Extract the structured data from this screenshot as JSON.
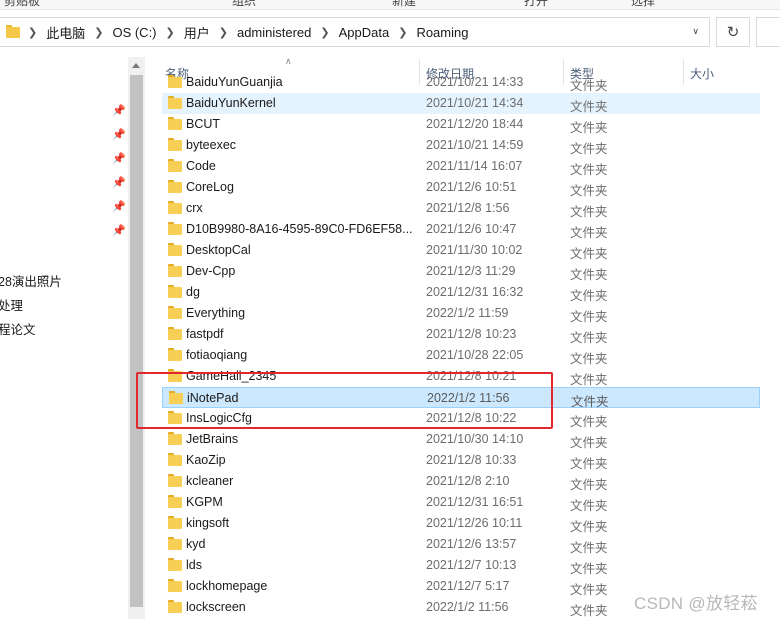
{
  "ribbon": {
    "items": [
      "剪贴板",
      "组织",
      "新建",
      "打开",
      "选择"
    ]
  },
  "address_bar": {
    "crumbs": [
      "此电脑",
      "OS (C:)",
      "用户",
      "administered",
      "AppData",
      "Roaming"
    ]
  },
  "nav_pane": {
    "items": [
      "28演出照片",
      "处理",
      "程论文"
    ]
  },
  "columns": {
    "name": "名称",
    "date": "修改日期",
    "type": "类型",
    "size": "大小"
  },
  "files": [
    {
      "name": "BaiduYunGuanjia",
      "date": "2021/10/21 14:33",
      "type": "文件夹"
    },
    {
      "name": "BaiduYunKernel",
      "date": "2021/10/21 14:34",
      "type": "文件夹"
    },
    {
      "name": "BCUT",
      "date": "2021/12/20 18:44",
      "type": "文件夹"
    },
    {
      "name": "byteexec",
      "date": "2021/10/21 14:59",
      "type": "文件夹"
    },
    {
      "name": "Code",
      "date": "2021/11/14 16:07",
      "type": "文件夹"
    },
    {
      "name": "CoreLog",
      "date": "2021/12/6 10:51",
      "type": "文件夹"
    },
    {
      "name": "crx",
      "date": "2021/12/8 1:56",
      "type": "文件夹"
    },
    {
      "name": "D10B9980-8A16-4595-89C0-FD6EF58...",
      "date": "2021/12/6 10:47",
      "type": "文件夹"
    },
    {
      "name": "DesktopCal",
      "date": "2021/11/30 10:02",
      "type": "文件夹"
    },
    {
      "name": "Dev-Cpp",
      "date": "2021/12/3 11:29",
      "type": "文件夹"
    },
    {
      "name": "dg",
      "date": "2021/12/31 16:32",
      "type": "文件夹"
    },
    {
      "name": "Everything",
      "date": "2022/1/2 11:59",
      "type": "文件夹"
    },
    {
      "name": "fastpdf",
      "date": "2021/12/8 10:23",
      "type": "文件夹"
    },
    {
      "name": "fotiaoqiang",
      "date": "2021/10/28 22:05",
      "type": "文件夹"
    },
    {
      "name": "GameHall_2345",
      "date": "2021/12/8 10:21",
      "type": "文件夹"
    },
    {
      "name": "iNotePad",
      "date": "2022/1/2 11:56",
      "type": "文件夹"
    },
    {
      "name": "InsLogicCfg",
      "date": "2021/12/8 10:22",
      "type": "文件夹"
    },
    {
      "name": "JetBrains",
      "date": "2021/10/30 14:10",
      "type": "文件夹"
    },
    {
      "name": "KaoZip",
      "date": "2021/12/8 10:33",
      "type": "文件夹"
    },
    {
      "name": "kcleaner",
      "date": "2021/12/8 2:10",
      "type": "文件夹"
    },
    {
      "name": "KGPM",
      "date": "2021/12/31 16:51",
      "type": "文件夹"
    },
    {
      "name": "kingsoft",
      "date": "2021/12/26 10:11",
      "type": "文件夹"
    },
    {
      "name": "kyd",
      "date": "2021/12/6 13:57",
      "type": "文件夹"
    },
    {
      "name": "lds",
      "date": "2021/12/7 10:13",
      "type": "文件夹"
    },
    {
      "name": "lockhomepage",
      "date": "2021/12/7 5:17",
      "type": "文件夹"
    },
    {
      "name": "lockscreen",
      "date": "2022/1/2 11:56",
      "type": "文件夹"
    }
  ],
  "selected_index": 15,
  "hover_index": 1,
  "watermark": "CSDN @放轻菘",
  "colors": {
    "selected_bg": "#cce8ff",
    "hover_bg": "#e5f3ff",
    "annotation_red": "#e0282e",
    "folder_yellow": "#f7cf55"
  }
}
